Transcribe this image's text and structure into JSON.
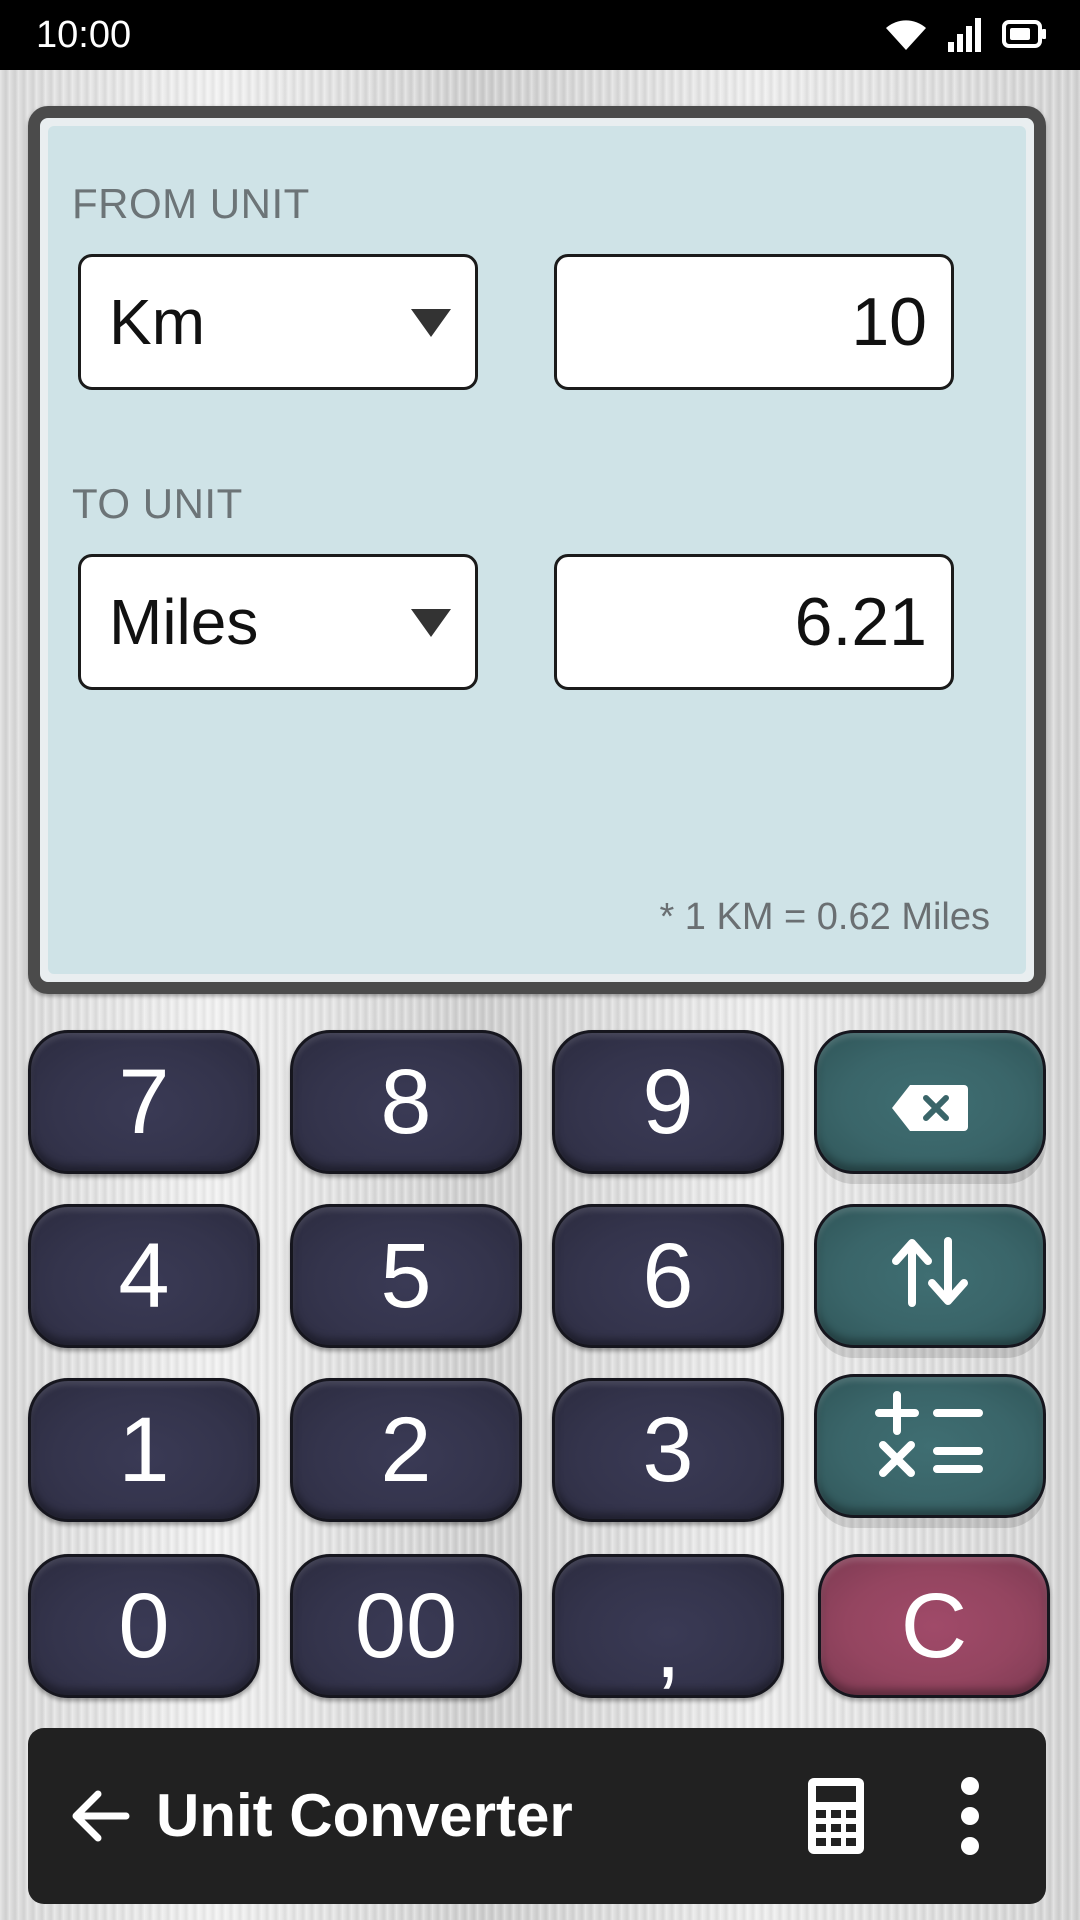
{
  "status_bar": {
    "time": "10:00",
    "icons": [
      "wifi-icon",
      "signal-icon",
      "battery-icon"
    ]
  },
  "converter": {
    "from_label": "FROM UNIT",
    "from_unit": "Km",
    "from_value": "10",
    "to_label": "TO UNIT",
    "to_unit": "Miles",
    "to_value": "6.21",
    "footnote": "* 1 KM = 0.62 Miles"
  },
  "keypad": {
    "keys": [
      "7",
      "8",
      "9",
      "4",
      "5",
      "6",
      "1",
      "2",
      "3",
      "0",
      "00",
      ",",
      "C"
    ],
    "function_keys": [
      "backspace-icon",
      "swap-icon",
      "operators-icon"
    ]
  },
  "app_bar": {
    "title": "Unit Converter",
    "icons": [
      "back-arrow-icon",
      "calculator-icon",
      "more-vert-icon"
    ]
  },
  "colors": {
    "number_key": "#34344c",
    "function_key": "#3a6569",
    "clear_key": "#944560",
    "display_bg": "#cfe3e7",
    "app_bar_bg": "#212121"
  }
}
